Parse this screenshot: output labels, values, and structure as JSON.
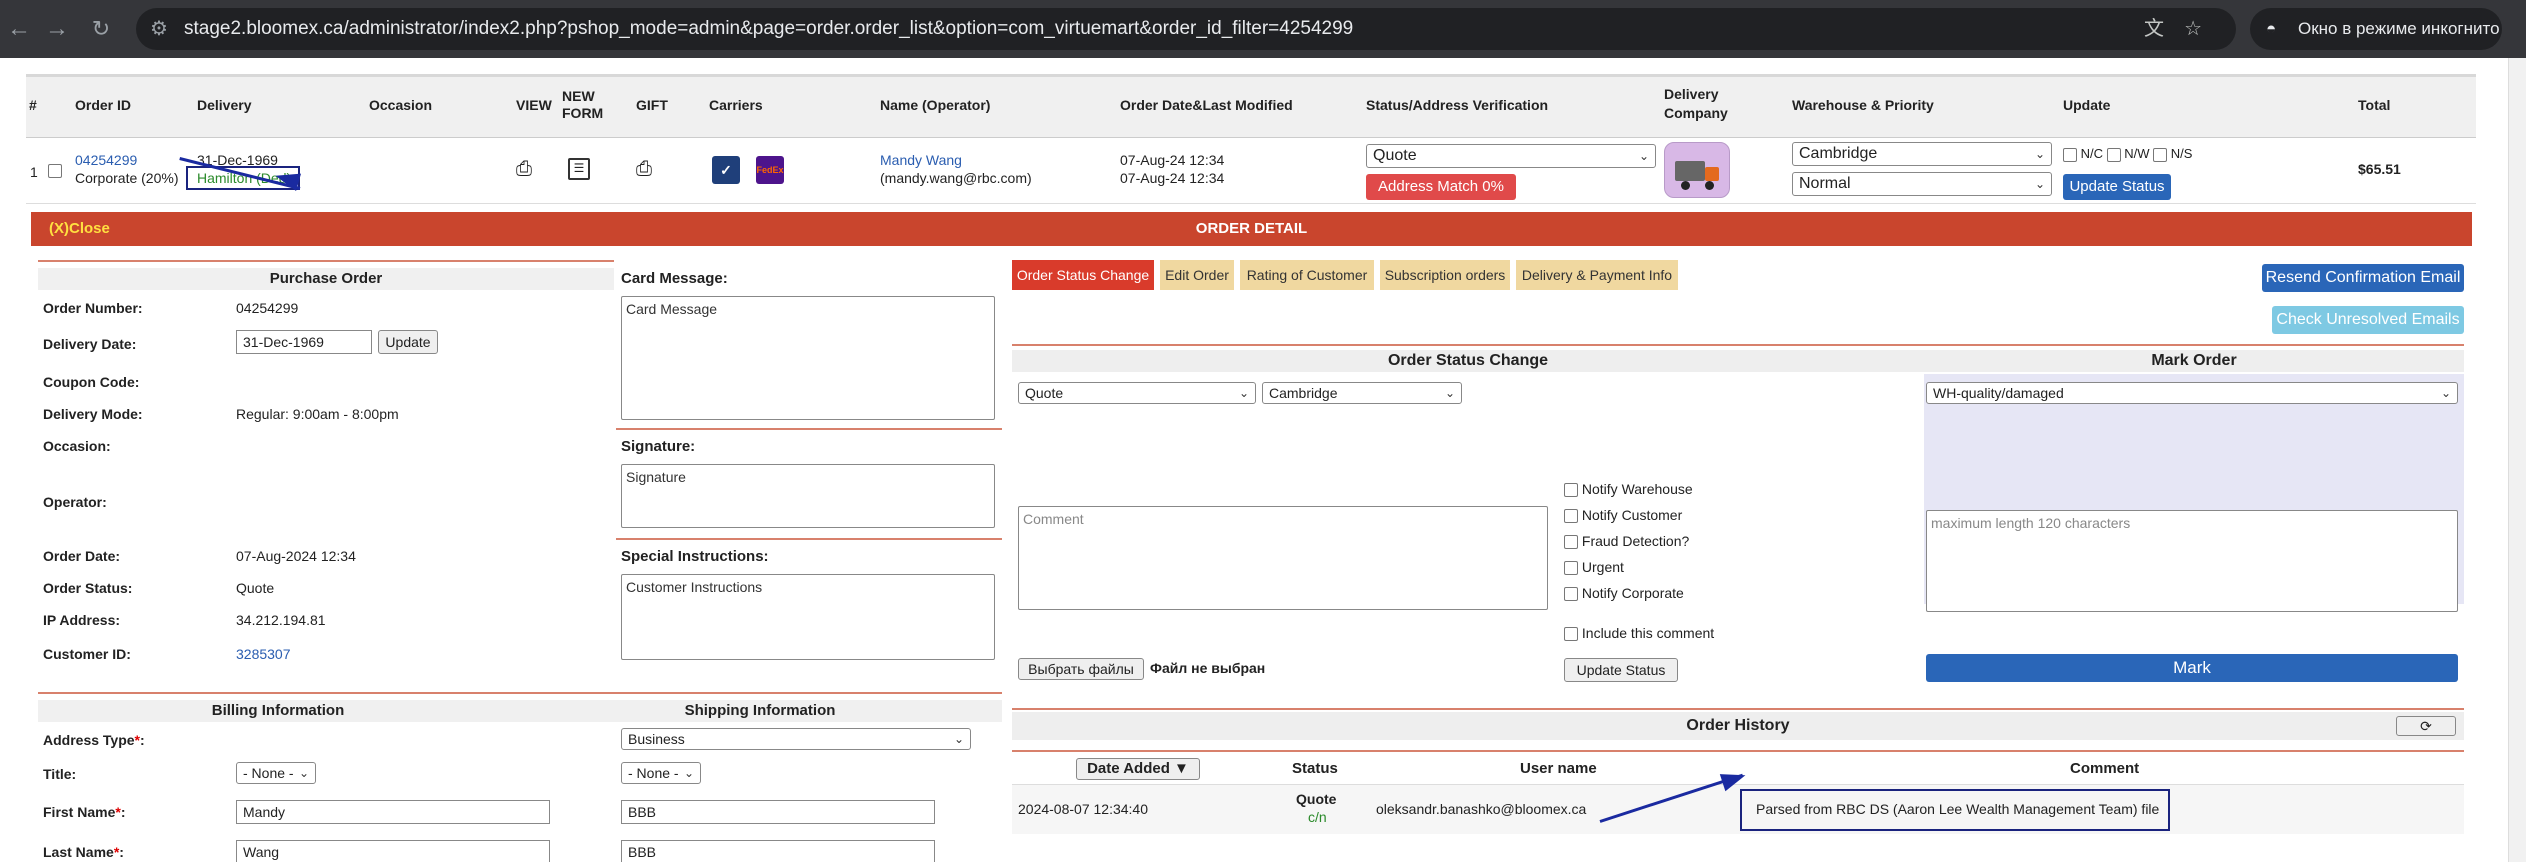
{
  "browser": {
    "url": "stage2.bloomex.ca/administrator/index2.php?pshop_mode=admin&page=order.order_list&option=com_virtuemart&order_id_filter=4254299",
    "incognito_label": "Окно в режиме инкогнито"
  },
  "headers": {
    "num": "#",
    "order_id": "Order ID",
    "delivery": "Delivery",
    "occasion": "Occasion",
    "view": "VIEW",
    "new_form_1": "NEW",
    "new_form_2": "FORM",
    "gift": "GIFT",
    "carriers": "Carriers",
    "name": "Name (Operator)",
    "order_date": "Order Date&Last Modified",
    "status": "Status/Address Verification",
    "delivery_company_1": "Delivery",
    "delivery_company_2": "Company",
    "warehouse": "Warehouse & Priority",
    "update": "Update",
    "total": "Total"
  },
  "order_row": {
    "index": "1",
    "order_id": "04254299",
    "order_type": "Corporate (20%)",
    "delivery_date": "31-Dec-1969",
    "delivery_city": "Hamilton (Ded)",
    "carrier_fedex": "FedEx",
    "name": "Mandy Wang",
    "email": "(mandy.wang@rbc.com)",
    "date_created": "07-Aug-24 12:34",
    "date_modified": "07-Aug-24 12:34",
    "status_value": "Quote",
    "address_match": "Address Match 0%",
    "warehouse_value": "Cambridge",
    "priority_value": "Normal",
    "nc": "N/C",
    "nw": "N/W",
    "ns": "N/S",
    "update_status": "Update Status",
    "total": "$65.51"
  },
  "order_detail": {
    "close": "(X)Close",
    "title": "ORDER DETAIL"
  },
  "purchase_order": {
    "title": "Purchase Order",
    "order_number_label": "Order Number:",
    "order_number": "04254299",
    "delivery_date_label": "Delivery Date:",
    "delivery_date": "31-Dec-1969",
    "update_btn": "Update",
    "coupon_label": "Coupon Code:",
    "delivery_mode_label": "Delivery Mode:",
    "delivery_mode": "Regular: 9:00am - 8:00pm",
    "occasion_label": "Occasion:",
    "operator_label": "Operator:",
    "order_date_label": "Order Date:",
    "order_date": "07-Aug-2024 12:34",
    "order_status_label": "Order Status:",
    "order_status": "Quote",
    "ip_label": "IP Address:",
    "ip": "34.212.194.81",
    "customer_id_label": "Customer ID:",
    "customer_id": "3285307"
  },
  "messages": {
    "card_label": "Card Message:",
    "card_value": "Card Message",
    "signature_label": "Signature:",
    "signature_value": "Signature",
    "special_label": "Special Instructions:",
    "special_value": "Customer Instructions"
  },
  "billing": {
    "billing_title": "Billing Information",
    "shipping_title": "Shipping Information",
    "address_type_label": "Address Type",
    "address_type": "Business",
    "title_label": "Title:",
    "title_billing": "- None -",
    "title_shipping": "- None -",
    "first_name_label": "First Name",
    "first_billing": "Mandy",
    "first_shipping": "BBB",
    "last_name_label": "Last Name",
    "last_billing": "Wang",
    "last_shipping": "BBB",
    "required": "*",
    "colon": ":"
  },
  "tabs": [
    "Order Status Change",
    "Edit Order",
    "Rating of Customer",
    "Subscription orders",
    "Delivery & Payment Info"
  ],
  "actions": {
    "resend": "Resend Confirmation Email",
    "check_unresolved": "Check Unresolved Emails"
  },
  "status_change": {
    "title": "Order Status Change",
    "status_select": "Quote",
    "warehouse_select": "Cambridge",
    "comment_placeholder": "Comment",
    "notify_warehouse": "Notify Warehouse",
    "notify_customer": "Notify Customer",
    "fraud": "Fraud Detection?",
    "urgent": "Urgent",
    "notify_corporate": "Notify Corporate",
    "include_comment": "Include this comment",
    "choose_files": "Выбрать файлы",
    "no_file": "Файл не выбран",
    "update_status": "Update Status"
  },
  "mark_order": {
    "title": "Mark Order",
    "select": "WH-quality/damaged",
    "placeholder": "maximum length 120 characters",
    "mark_btn": "Mark"
  },
  "history": {
    "title": "Order History",
    "col_date": "Date Added ▼",
    "col_status": "Status",
    "col_user": "User name",
    "col_comment": "Comment",
    "rows": [
      {
        "date": "2024-08-07 12:34:40",
        "status": "Quote",
        "status_sub": "c/n",
        "user": "oleksandr.banashko@bloomex.ca",
        "comment": "Parsed from RBC DS (Aaron Lee Wealth Management Team) file"
      }
    ]
  }
}
